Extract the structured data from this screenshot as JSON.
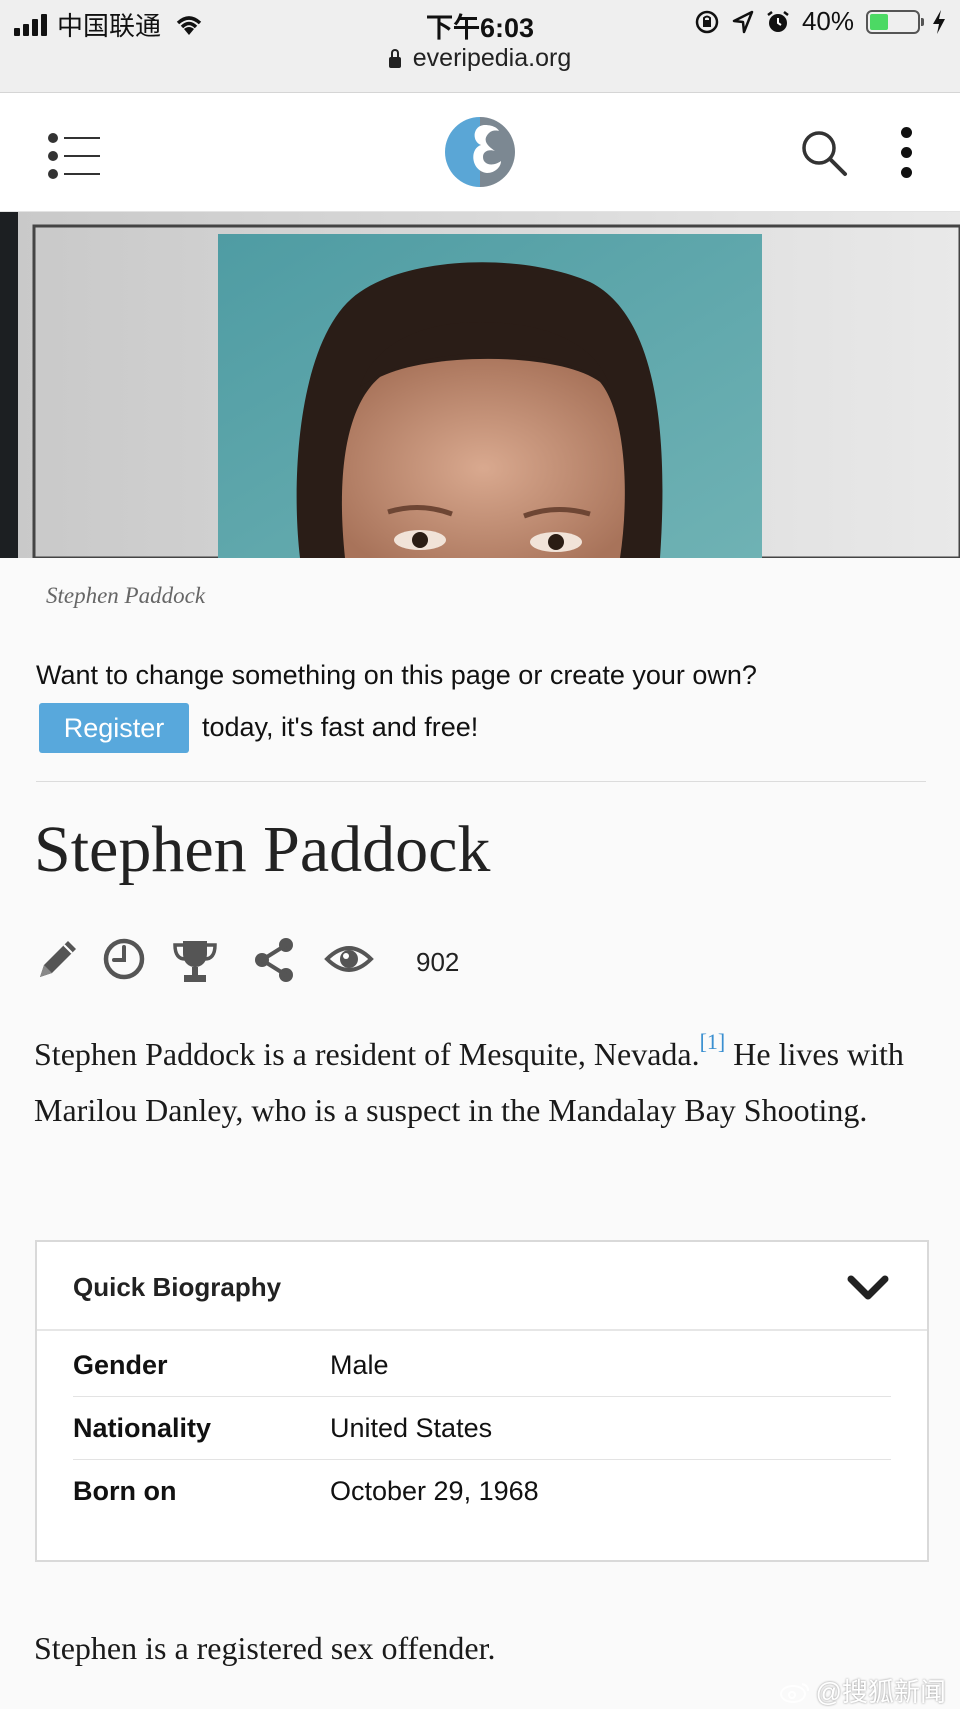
{
  "status_bar": {
    "carrier": "中国联通",
    "time": "下午6:03",
    "battery": "40%",
    "battery_level": 0.4,
    "url": "everipedia.org"
  },
  "header": {
    "menu_icon": "menu-icon",
    "logo": "everipedia-logo",
    "search_icon": "search-icon",
    "more_icon": "more-vertical-icon"
  },
  "hero": {
    "caption": "Stephen Paddock"
  },
  "register_prompt": {
    "text": "Want to change something on this page or create your own?",
    "button_label": "Register",
    "tail": "today, it's fast and free!"
  },
  "article": {
    "title": "Stephen Paddock",
    "toolbar": {
      "icons": [
        "pencil-icon",
        "history-clock-icon",
        "trophy-icon",
        "share-icon",
        "eye-icon"
      ],
      "views": "902"
    },
    "lead_part1": "Stephen Paddock is a resident of Mesquite, Nevada.",
    "citation": "[1]",
    "lead_part2": " He lives with Marilou Danley, who is a suspect in the Mandalay Bay Shooting.",
    "quick_bio": {
      "title": "Quick Biography",
      "rows": [
        {
          "label": "Gender",
          "value": "Male"
        },
        {
          "label": "Nationality",
          "value": "United States"
        },
        {
          "label": "Born on",
          "value": "October 29, 1968"
        }
      ]
    },
    "paragraph2": "Stephen is a registered sex offender."
  },
  "watermark": {
    "text": "@搜狐新闻"
  },
  "colors": {
    "accent_blue": "#58a8dc",
    "link_blue": "#3a8fd0",
    "battery_green": "#4cd964"
  }
}
